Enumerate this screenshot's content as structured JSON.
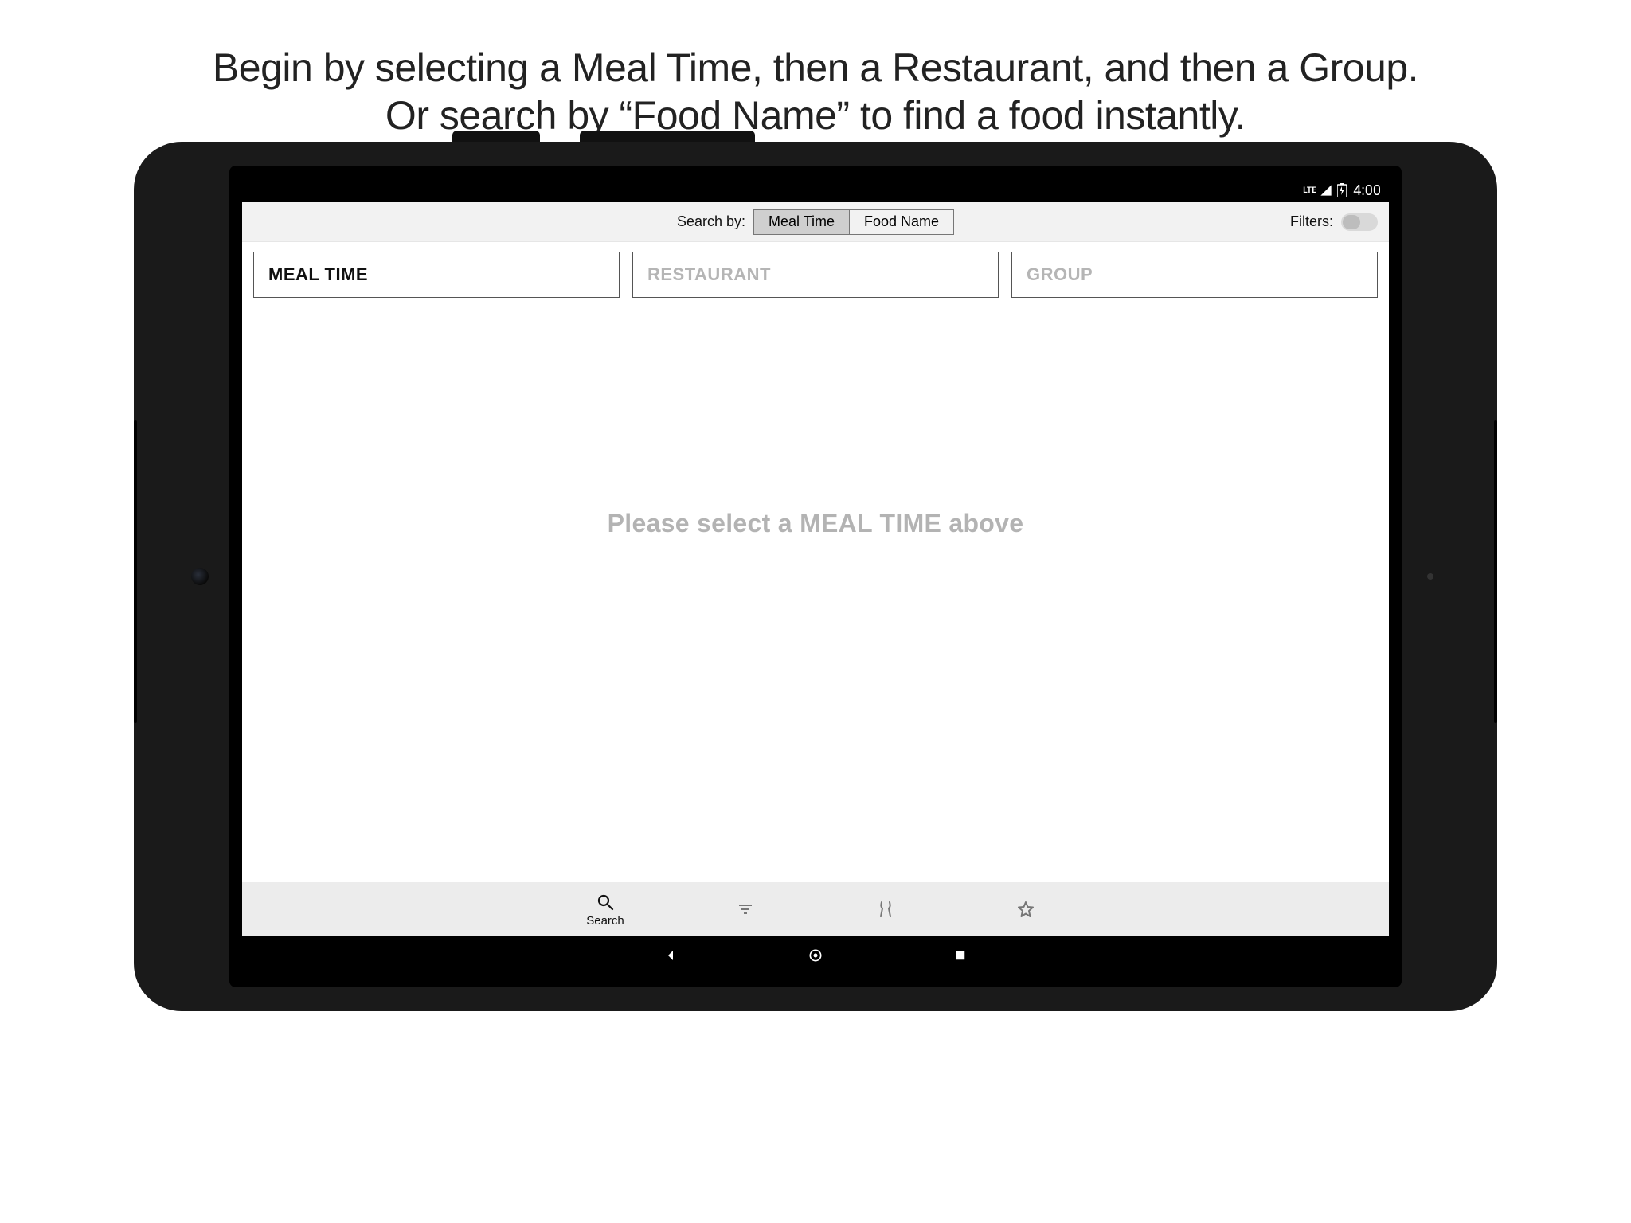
{
  "instructions": {
    "line1": "Begin by selecting a Meal Time, then a Restaurant, and then a Group.",
    "line2": "Or search by “Food Name” to find a food instantly."
  },
  "status_bar": {
    "network_label": "LTE",
    "time": "4:00"
  },
  "header": {
    "search_by_label": "Search by:",
    "segments": {
      "meal_time": "Meal Time",
      "food_name": "Food Name"
    },
    "filters_label": "Filters:",
    "filters_on": false
  },
  "selectors": {
    "meal_time": "MEAL TIME",
    "restaurant": "RESTAURANT",
    "group": "GROUP"
  },
  "content": {
    "placeholder": "Please select a MEAL TIME above"
  },
  "tabs": {
    "search": "Search"
  }
}
